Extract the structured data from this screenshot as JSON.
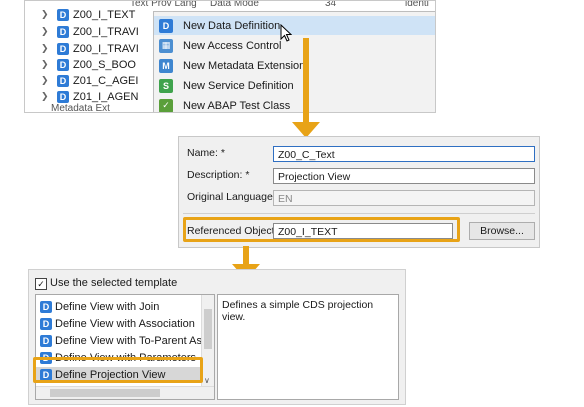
{
  "tree": {
    "items": [
      {
        "label": "Z00_I_TEXT"
      },
      {
        "label": "Z00_I_TRAVI"
      },
      {
        "label": "Z00_I_TRAVI"
      },
      {
        "label": "Z00_S_BOO"
      },
      {
        "label": "Z01_C_AGEI"
      },
      {
        "label": "Z01_I_AGEN"
      }
    ],
    "bg_text_1": "Text Prov Lang",
    "bg_text_2": "Data Mode",
    "bg_text_3": "34",
    "bg_text_4": "identi",
    "bg_text_5": "Metadata Ext"
  },
  "context_menu": {
    "items": [
      {
        "label": "New Data Definition",
        "icon": "ddl-icon"
      },
      {
        "label": "New Access Control",
        "icon": "access-control-icon"
      },
      {
        "label": "New Metadata Extension",
        "icon": "metadata-extension-icon"
      },
      {
        "label": "New Service Definition",
        "icon": "service-definition-icon"
      },
      {
        "label": "New ABAP Test Class",
        "icon": "test-class-icon"
      }
    ],
    "selected_index": 0
  },
  "form": {
    "name_label": "Name: *",
    "name_value": "Z00_C_Text",
    "description_label": "Description: *",
    "description_value": "Projection View",
    "language_label": "Original Language:",
    "language_value": "EN",
    "referenced_label": "Referenced Object:",
    "referenced_value": "Z00_I_TEXT",
    "browse_label": "Browse..."
  },
  "template": {
    "use_template_label": "Use the selected template",
    "use_template_checked": "✓",
    "items": [
      {
        "label": "Define View with Join"
      },
      {
        "label": "Define View with Association"
      },
      {
        "label": "Define View with To-Parent Assoc"
      },
      {
        "label": "Define View with Parameters"
      },
      {
        "label": "Define Projection View"
      }
    ],
    "selected_index": 4,
    "description": "Defines a simple CDS projection view."
  },
  "colors": {
    "highlight": "#e8a317",
    "ddl_icon": "#2e7bd6",
    "menu_selection": "#cfe3f6"
  }
}
